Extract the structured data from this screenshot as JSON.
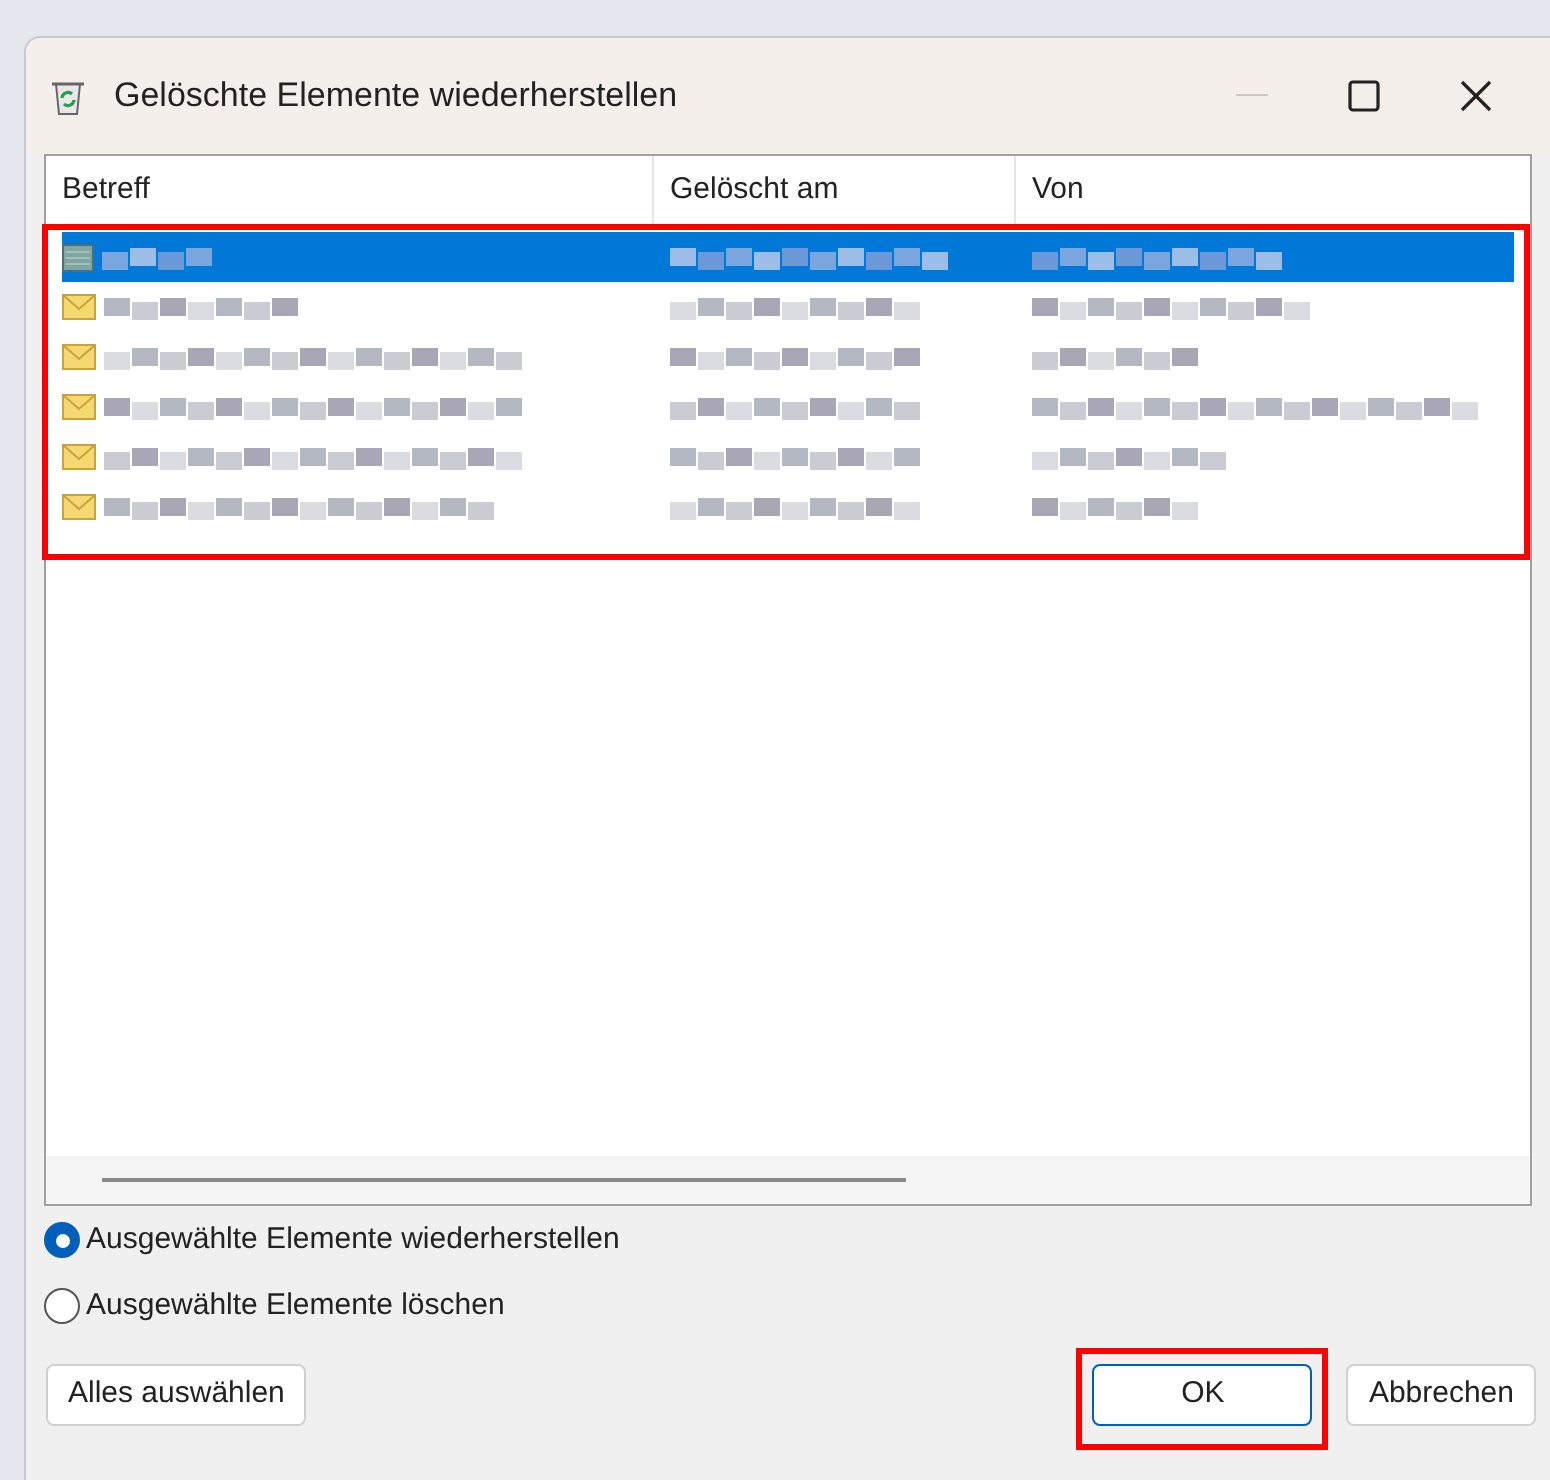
{
  "window": {
    "title": "Gelöschte Elemente wiederherstellen"
  },
  "table": {
    "columns": [
      "Betreff",
      "Gelöscht am",
      "Von"
    ],
    "highlighted": true,
    "rows": [
      {
        "kind": "note",
        "selected": true
      },
      {
        "kind": "mail",
        "selected": false
      },
      {
        "kind": "mail",
        "selected": false
      },
      {
        "kind": "mail",
        "selected": false
      },
      {
        "kind": "mail",
        "selected": false
      },
      {
        "kind": "mail",
        "selected": false
      }
    ]
  },
  "options": [
    {
      "label": "Ausgewählte Elemente wiederherstellen",
      "selected": true
    },
    {
      "label": "Ausgewählte Elemente löschen",
      "selected": false
    }
  ],
  "buttons": [
    {
      "label": "Alles auswählen",
      "highlighted": false
    },
    {
      "label": "OK",
      "highlighted": true
    },
    {
      "label": "Abbrechen",
      "highlighted": false
    }
  ]
}
